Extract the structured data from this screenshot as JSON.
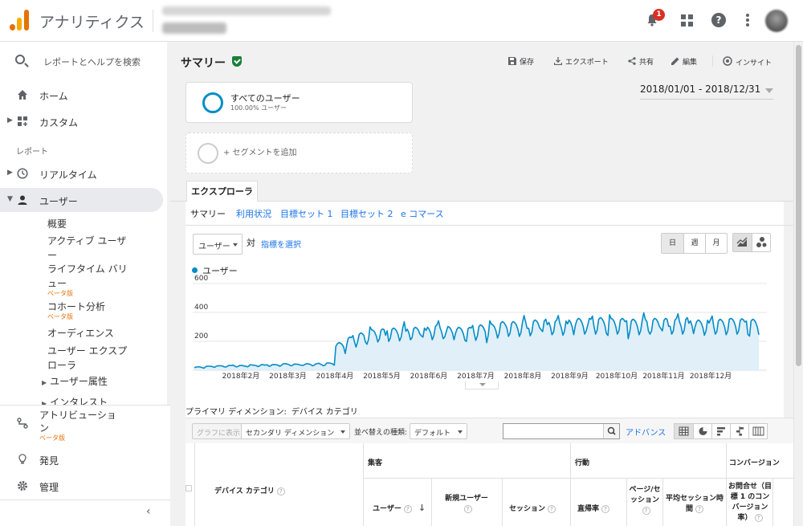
{
  "app": {
    "title": "アナリティクス",
    "notifications": "1",
    "help": "?"
  },
  "sidebar": {
    "search_placeholder": "レポートとヘルプを検索",
    "home": "ホーム",
    "custom": "カスタム",
    "section_reports": "レポート",
    "realtime": "リアルタイム",
    "users": "ユーザー",
    "users_sub": [
      "概要",
      "アクティブ ユーザー",
      "ライフタイム バリュー",
      "コホート分析",
      "オーディエンス",
      "ユーザー エクスプローラ",
      "ユーザー属性",
      "インタレスト"
    ],
    "beta": "ベータ版",
    "attribution": "アトリビューション",
    "discover": "発見",
    "admin": "管理"
  },
  "page": {
    "title": "サマリー",
    "actions": {
      "save": "保存",
      "export": "エクスポート",
      "share": "共有",
      "edit": "編集",
      "insights": "インサイト"
    },
    "date_range": "2018/01/01 - 2018/12/31",
    "segment": {
      "name": "すべてのユーザー",
      "pct": "100.00% ユーザー",
      "add": "+ セグメントを追加"
    },
    "tab": "エクスプローラ",
    "subtabs": [
      "サマリー",
      "利用状況",
      "目標セット 1",
      "目標セット 2",
      "e コマース"
    ],
    "metric": "ユーザー",
    "vs": "対",
    "pick_metric": "指標を選択",
    "granularity": [
      "日",
      "週",
      "月"
    ]
  },
  "chart_data": {
    "type": "line",
    "series": [
      {
        "name": "ユーザー"
      }
    ],
    "ylim": [
      0,
      600
    ],
    "yticks": [
      "600",
      "400",
      "200"
    ],
    "xticks": [
      "2018年2月",
      "2018年3月",
      "2018年4月",
      "2018年5月",
      "2018年6月",
      "2018年7月",
      "2018年8月",
      "2018年9月",
      "2018年10月",
      "2018年11月",
      "2018年12月"
    ],
    "weekly": [
      20,
      25,
      28,
      30,
      30,
      32,
      35,
      35,
      40,
      38,
      40,
      40,
      45,
      170,
      205,
      230,
      250,
      255,
      260,
      270,
      265,
      270,
      280,
      270,
      265,
      265,
      280,
      285,
      300,
      300,
      305,
      310,
      315,
      310,
      315,
      320,
      320,
      325,
      320,
      320,
      315,
      320,
      320,
      320,
      320,
      325,
      310,
      320,
      315,
      320,
      318,
      315
    ],
    "color": "#058dc7",
    "fill": "#e0eff8"
  },
  "table": {
    "primary_dimension_label": "プライマリ ディメンション:",
    "primary_dimension": "デバイス カテゴリ",
    "plot_rows": "グラフに表示",
    "secondary_dimension": "セカンダリ ディメンション",
    "sort_label": "並べ替えの種類:",
    "sort_value": "デフォルト",
    "advanced": "アドバンス",
    "groups": [
      "集客",
      "行動",
      "コンバージョン"
    ],
    "columns": [
      "デバイス カテゴリ",
      "ユーザー",
      "新規ユーザー",
      "セッション",
      "直帰率",
      "ページ/セッション",
      "平均セッション時間",
      "お問合せ（目標 1 のコンバージョン率）"
    ]
  }
}
